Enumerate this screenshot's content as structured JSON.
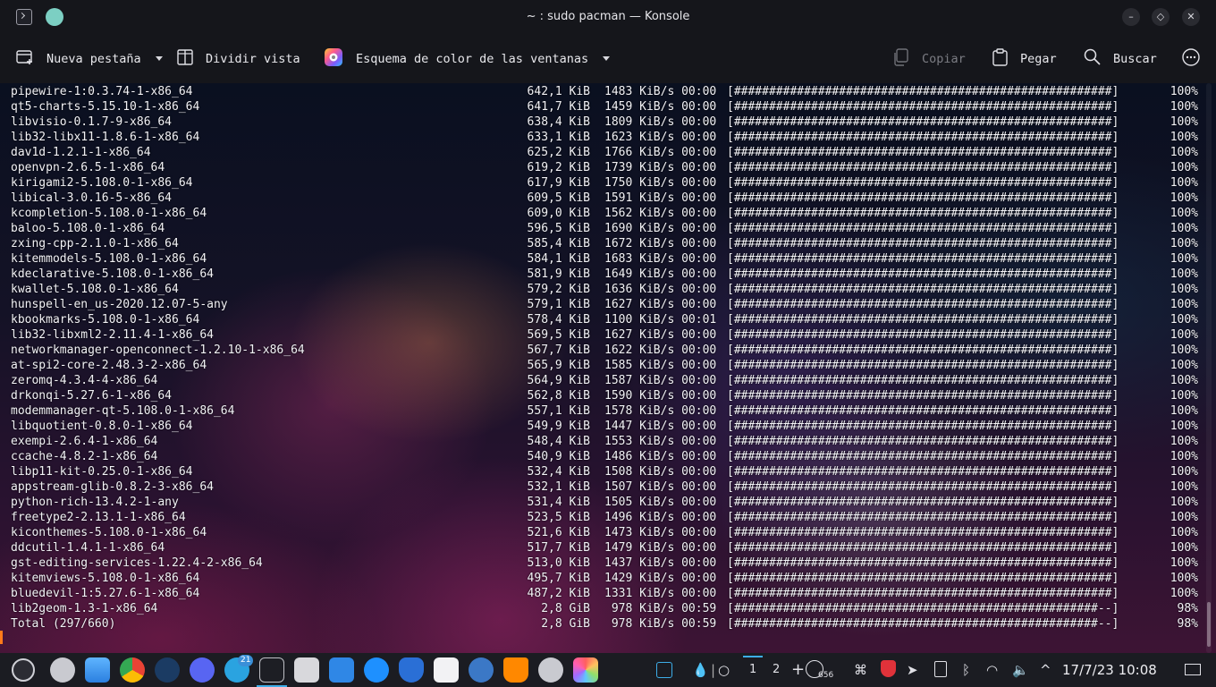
{
  "window": {
    "title": "~ : sudo pacman — Konsole",
    "icons": [
      "konsole-icon",
      "pin-icon"
    ],
    "controls": {
      "minimize": "–",
      "maximize": "◇",
      "close": "✕"
    }
  },
  "toolbar": {
    "new_tab_label": "Nueva pestaña",
    "split_view_label": "Dividir vista",
    "color_scheme_label": "Esquema de color de las ventanas",
    "copy_label": "Copiar",
    "paste_label": "Pegar",
    "search_label": "Buscar",
    "menu_icon": "more-icon"
  },
  "terminal": {
    "rows": [
      {
        "name": "pipewire-1:0.3.74-1-x86_64",
        "size": "642,1 KiB",
        "rate": "1483 KiB/s 00:00",
        "bar": "[######################################################]",
        "pct": "100%"
      },
      {
        "name": "qt5-charts-5.15.10-1-x86_64",
        "size": "641,7 KiB",
        "rate": "1459 KiB/s 00:00",
        "bar": "[######################################################]",
        "pct": "100%"
      },
      {
        "name": "libvisio-0.1.7-9-x86_64",
        "size": "638,4 KiB",
        "rate": "1809 KiB/s 00:00",
        "bar": "[######################################################]",
        "pct": "100%"
      },
      {
        "name": "lib32-libx11-1.8.6-1-x86_64",
        "size": "633,1 KiB",
        "rate": "1623 KiB/s 00:00",
        "bar": "[######################################################]",
        "pct": "100%"
      },
      {
        "name": "dav1d-1.2.1-1-x86_64",
        "size": "625,2 KiB",
        "rate": "1766 KiB/s 00:00",
        "bar": "[######################################################]",
        "pct": "100%"
      },
      {
        "name": "openvpn-2.6.5-1-x86_64",
        "size": "619,2 KiB",
        "rate": "1739 KiB/s 00:00",
        "bar": "[######################################################]",
        "pct": "100%"
      },
      {
        "name": "kirigami2-5.108.0-1-x86_64",
        "size": "617,9 KiB",
        "rate": "1750 KiB/s 00:00",
        "bar": "[######################################################]",
        "pct": "100%"
      },
      {
        "name": "libical-3.0.16-5-x86_64",
        "size": "609,5 KiB",
        "rate": "1591 KiB/s 00:00",
        "bar": "[######################################################]",
        "pct": "100%"
      },
      {
        "name": "kcompletion-5.108.0-1-x86_64",
        "size": "609,0 KiB",
        "rate": "1562 KiB/s 00:00",
        "bar": "[######################################################]",
        "pct": "100%"
      },
      {
        "name": "baloo-5.108.0-1-x86_64",
        "size": "596,5 KiB",
        "rate": "1690 KiB/s 00:00",
        "bar": "[######################################################]",
        "pct": "100%"
      },
      {
        "name": "zxing-cpp-2.1.0-1-x86_64",
        "size": "585,4 KiB",
        "rate": "1672 KiB/s 00:00",
        "bar": "[######################################################]",
        "pct": "100%"
      },
      {
        "name": "kitemmodels-5.108.0-1-x86_64",
        "size": "584,1 KiB",
        "rate": "1683 KiB/s 00:00",
        "bar": "[######################################################]",
        "pct": "100%"
      },
      {
        "name": "kdeclarative-5.108.0-1-x86_64",
        "size": "581,9 KiB",
        "rate": "1649 KiB/s 00:00",
        "bar": "[######################################################]",
        "pct": "100%"
      },
      {
        "name": "kwallet-5.108.0-1-x86_64",
        "size": "579,2 KiB",
        "rate": "1636 KiB/s 00:00",
        "bar": "[######################################################]",
        "pct": "100%"
      },
      {
        "name": "hunspell-en_us-2020.12.07-5-any",
        "size": "579,1 KiB",
        "rate": "1627 KiB/s 00:00",
        "bar": "[######################################################]",
        "pct": "100%"
      },
      {
        "name": "kbookmarks-5.108.0-1-x86_64",
        "size": "578,4 KiB",
        "rate": "1100 KiB/s 00:01",
        "bar": "[######################################################]",
        "pct": "100%"
      },
      {
        "name": "lib32-libxml2-2.11.4-1-x86_64",
        "size": "569,5 KiB",
        "rate": "1627 KiB/s 00:00",
        "bar": "[######################################################]",
        "pct": "100%"
      },
      {
        "name": "networkmanager-openconnect-1.2.10-1-x86_64",
        "size": "567,7 KiB",
        "rate": "1622 KiB/s 00:00",
        "bar": "[######################################################]",
        "pct": "100%"
      },
      {
        "name": "at-spi2-core-2.48.3-2-x86_64",
        "size": "565,9 KiB",
        "rate": "1585 KiB/s 00:00",
        "bar": "[######################################################]",
        "pct": "100%"
      },
      {
        "name": "zeromq-4.3.4-4-x86_64",
        "size": "564,9 KiB",
        "rate": "1587 KiB/s 00:00",
        "bar": "[######################################################]",
        "pct": "100%"
      },
      {
        "name": "drkonqi-5.27.6-1-x86_64",
        "size": "562,8 KiB",
        "rate": "1590 KiB/s 00:00",
        "bar": "[######################################################]",
        "pct": "100%"
      },
      {
        "name": "modemmanager-qt-5.108.0-1-x86_64",
        "size": "557,1 KiB",
        "rate": "1578 KiB/s 00:00",
        "bar": "[######################################################]",
        "pct": "100%"
      },
      {
        "name": "libquotient-0.8.0-1-x86_64",
        "size": "549,9 KiB",
        "rate": "1447 KiB/s 00:00",
        "bar": "[######################################################]",
        "pct": "100%"
      },
      {
        "name": "exempi-2.6.4-1-x86_64",
        "size": "548,4 KiB",
        "rate": "1553 KiB/s 00:00",
        "bar": "[######################################################]",
        "pct": "100%"
      },
      {
        "name": "ccache-4.8.2-1-x86_64",
        "size": "540,9 KiB",
        "rate": "1486 KiB/s 00:00",
        "bar": "[######################################################]",
        "pct": "100%"
      },
      {
        "name": "libp11-kit-0.25.0-1-x86_64",
        "size": "532,4 KiB",
        "rate": "1508 KiB/s 00:00",
        "bar": "[######################################################]",
        "pct": "100%"
      },
      {
        "name": "appstream-glib-0.8.2-3-x86_64",
        "size": "532,1 KiB",
        "rate": "1507 KiB/s 00:00",
        "bar": "[######################################################]",
        "pct": "100%"
      },
      {
        "name": "python-rich-13.4.2-1-any",
        "size": "531,4 KiB",
        "rate": "1505 KiB/s 00:00",
        "bar": "[######################################################]",
        "pct": "100%"
      },
      {
        "name": "freetype2-2.13.1-1-x86_64",
        "size": "523,5 KiB",
        "rate": "1496 KiB/s 00:00",
        "bar": "[######################################################]",
        "pct": "100%"
      },
      {
        "name": "kiconthemes-5.108.0-1-x86_64",
        "size": "521,6 KiB",
        "rate": "1473 KiB/s 00:00",
        "bar": "[######################################################]",
        "pct": "100%"
      },
      {
        "name": "ddcutil-1.4.1-1-x86_64",
        "size": "517,7 KiB",
        "rate": "1479 KiB/s 00:00",
        "bar": "[######################################################]",
        "pct": "100%"
      },
      {
        "name": "gst-editing-services-1.22.4-2-x86_64",
        "size": "513,0 KiB",
        "rate": "1437 KiB/s 00:00",
        "bar": "[######################################################]",
        "pct": "100%"
      },
      {
        "name": "kitemviews-5.108.0-1-x86_64",
        "size": "495,7 KiB",
        "rate": "1429 KiB/s 00:00",
        "bar": "[######################################################]",
        "pct": "100%"
      },
      {
        "name": "bluedevil-1:5.27.6-1-x86_64",
        "size": "487,2 KiB",
        "rate": "1331 KiB/s 00:00",
        "bar": "[######################################################]",
        "pct": "100%"
      },
      {
        "name": "lib2geom-1.3-1-x86_64",
        "size": "2,8 GiB",
        "rate": " 978 KiB/s 00:59",
        "bar": "[####################################################--]",
        "pct": "98%"
      },
      {
        "name": "Total (297/660)",
        "size": "2,8 GiB",
        "rate": " 978 KiB/s 00:59",
        "bar": "[####################################################--]",
        "pct": "98%"
      }
    ]
  },
  "taskbar": {
    "apps": [
      "app-launcher-icon",
      "settings-icon",
      "files-icon",
      "chrome-icon",
      "steam-icon",
      "discord-icon",
      "telegram-icon",
      "konsole-icon",
      "kvantum-icon",
      "discover-icon",
      "downloader-icon",
      "vpn-shield-icon",
      "system-monitor-icon",
      "thunderbird-icon",
      "vlc-icon",
      "system-settings-icon",
      "photos-icon"
    ],
    "telegram_badge": "21",
    "desktops": [
      "1",
      "2"
    ],
    "updates_count": "656",
    "clock": "17/7/23 10:08",
    "tray_icons": [
      "window-icon",
      "droplet-icon",
      "circle-icon",
      "add-icon",
      "updates-icon",
      "command-icon",
      "shield-icon",
      "telegram-tray-icon",
      "clipboard-icon",
      "bluetooth-icon",
      "wifi-icon",
      "volume-icon",
      "chevron-up-icon",
      "show-desktop-icon"
    ]
  },
  "colors": {
    "background": "#15161b",
    "cursor": "#ff7a1a",
    "accent": "#3daee9"
  }
}
